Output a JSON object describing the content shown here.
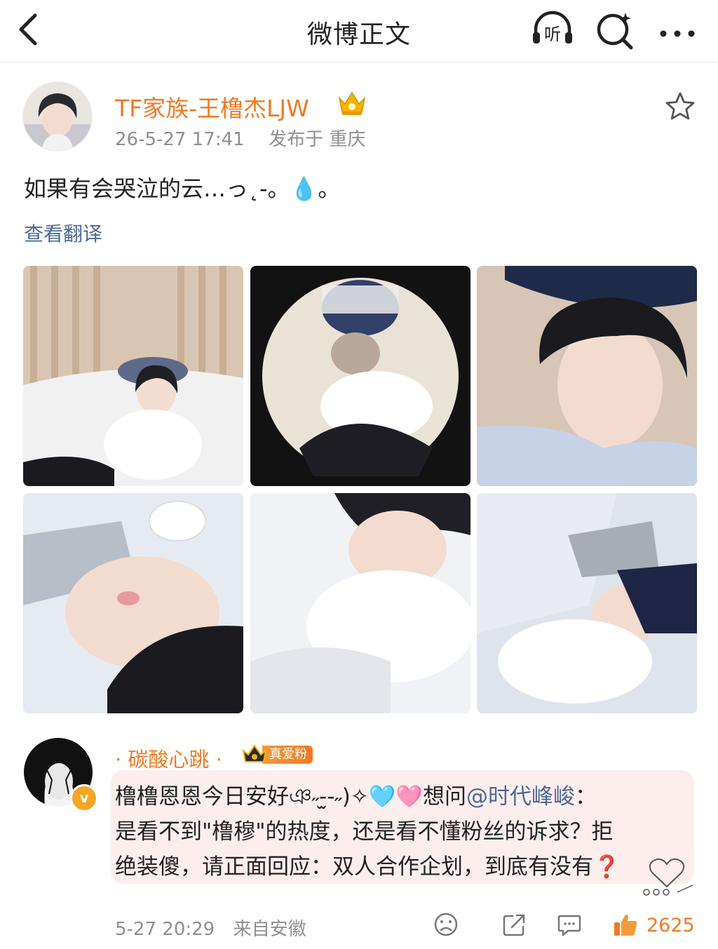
{
  "header": {
    "title": "微博正文",
    "listen_label": "听"
  },
  "post": {
    "author": "TF家族-王橹杰LJW",
    "timestamp": "26-5-27 17:41",
    "location": "发布于 重庆",
    "text": "如果有会哭泣的云…っ˛-。💧。",
    "translate_label": "查看翻译",
    "photo_count": 6
  },
  "comment": {
    "author": "· 碳酸心跳 ·",
    "fan_badge": "真爱粉",
    "verified_mark": "v",
    "line1_a": "橹橹恩恩今日安好ঞ˶-̫-˶)✧🩵🩷想问",
    "mention": "@时代峰峻",
    "line1_b": "：",
    "line2": "是看不到\"橹穆\"的热度，还是看不懂粉丝的诉求？拒",
    "line3": "绝装傻，请正面回应：双人合作企划，到底有没有❓",
    "timestamp": "5-27 20:29",
    "source": "来自安徽",
    "like_count": "2625"
  },
  "colors": {
    "accent_orange": "#f07a25",
    "link_blue": "#4a6a96",
    "meta_gray": "#8f8f8f",
    "bubble_pink": "#fdeeee"
  },
  "icons": [
    "back-arrow-icon",
    "listen-icon",
    "search-spark-icon",
    "more-icon",
    "star-icon",
    "crown-icon",
    "sad-face-icon",
    "share-icon",
    "comment-icon",
    "thumb-up-icon"
  ]
}
